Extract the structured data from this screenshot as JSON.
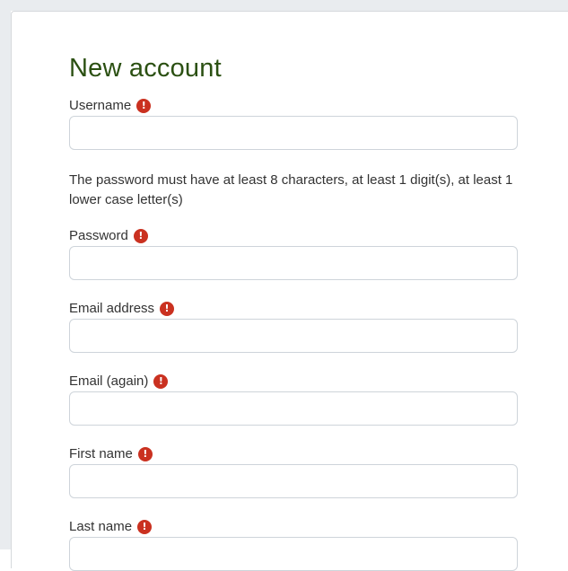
{
  "form": {
    "title": "New account",
    "password_policy": "The password must have at least 8 characters, at least 1 digit(s), at least 1 lower case letter(s)",
    "required_icon": "exclamation-circle-icon",
    "required_color": "#ca3120",
    "title_color": "#2b5012",
    "fields": {
      "username": {
        "label": "Username",
        "value": ""
      },
      "password": {
        "label": "Password",
        "value": ""
      },
      "email": {
        "label": "Email address",
        "value": ""
      },
      "email_again": {
        "label": "Email (again)",
        "value": ""
      },
      "first_name": {
        "label": "First name",
        "value": ""
      },
      "last_name": {
        "label": "Last name",
        "value": ""
      }
    }
  }
}
